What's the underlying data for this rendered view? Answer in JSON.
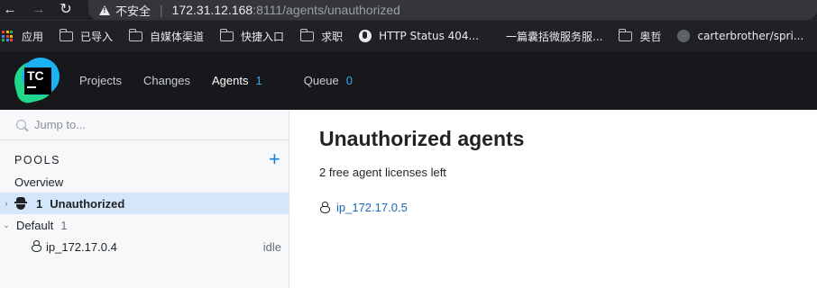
{
  "browser": {
    "insecure_label": "不安全",
    "url_host": "172.31.12.168",
    "url_rest": ":8111/agents/unauthorized",
    "bookmarks": [
      {
        "label": "应用",
        "icon": "apps-icon"
      },
      {
        "label": "已导入",
        "icon": "folder-icon"
      },
      {
        "label": "自媒体渠道",
        "icon": "folder-icon"
      },
      {
        "label": "快捷入口",
        "icon": "folder-icon"
      },
      {
        "label": "求职",
        "icon": "folder-icon"
      },
      {
        "label": "HTTP Status 404...",
        "icon": "globe-icon"
      },
      {
        "label": "一篇囊括微服务服...",
        "icon": "blank-icon"
      },
      {
        "label": "奥哲",
        "icon": "folder-icon"
      },
      {
        "label": "carterbrother/spri...",
        "icon": "github-icon"
      }
    ]
  },
  "header": {
    "logo_text": "TC",
    "nav": [
      {
        "label": "Projects",
        "count": ""
      },
      {
        "label": "Changes",
        "count": ""
      },
      {
        "label": "Agents",
        "count": "1"
      },
      {
        "label": "Queue",
        "count": "0"
      }
    ]
  },
  "sidebar": {
    "search_placeholder": "Jump to...",
    "pools_header": "POOLS",
    "add_label": "+",
    "overview": "Overview",
    "unauthorized": {
      "count": "1",
      "label": "Unauthorized"
    },
    "default_pool": {
      "label": "Default",
      "count": "1"
    },
    "agent": {
      "name": "ip_172.17.0.4",
      "status": "idle"
    }
  },
  "main": {
    "title": "Unauthorized agents",
    "licenses": "2 free agent licenses left",
    "agent_link": "ip_172.17.0.5"
  },
  "colors": {
    "accent": "#1a7fd7",
    "header_bg": "#16181b",
    "selected_row": "#d4e6fa"
  }
}
